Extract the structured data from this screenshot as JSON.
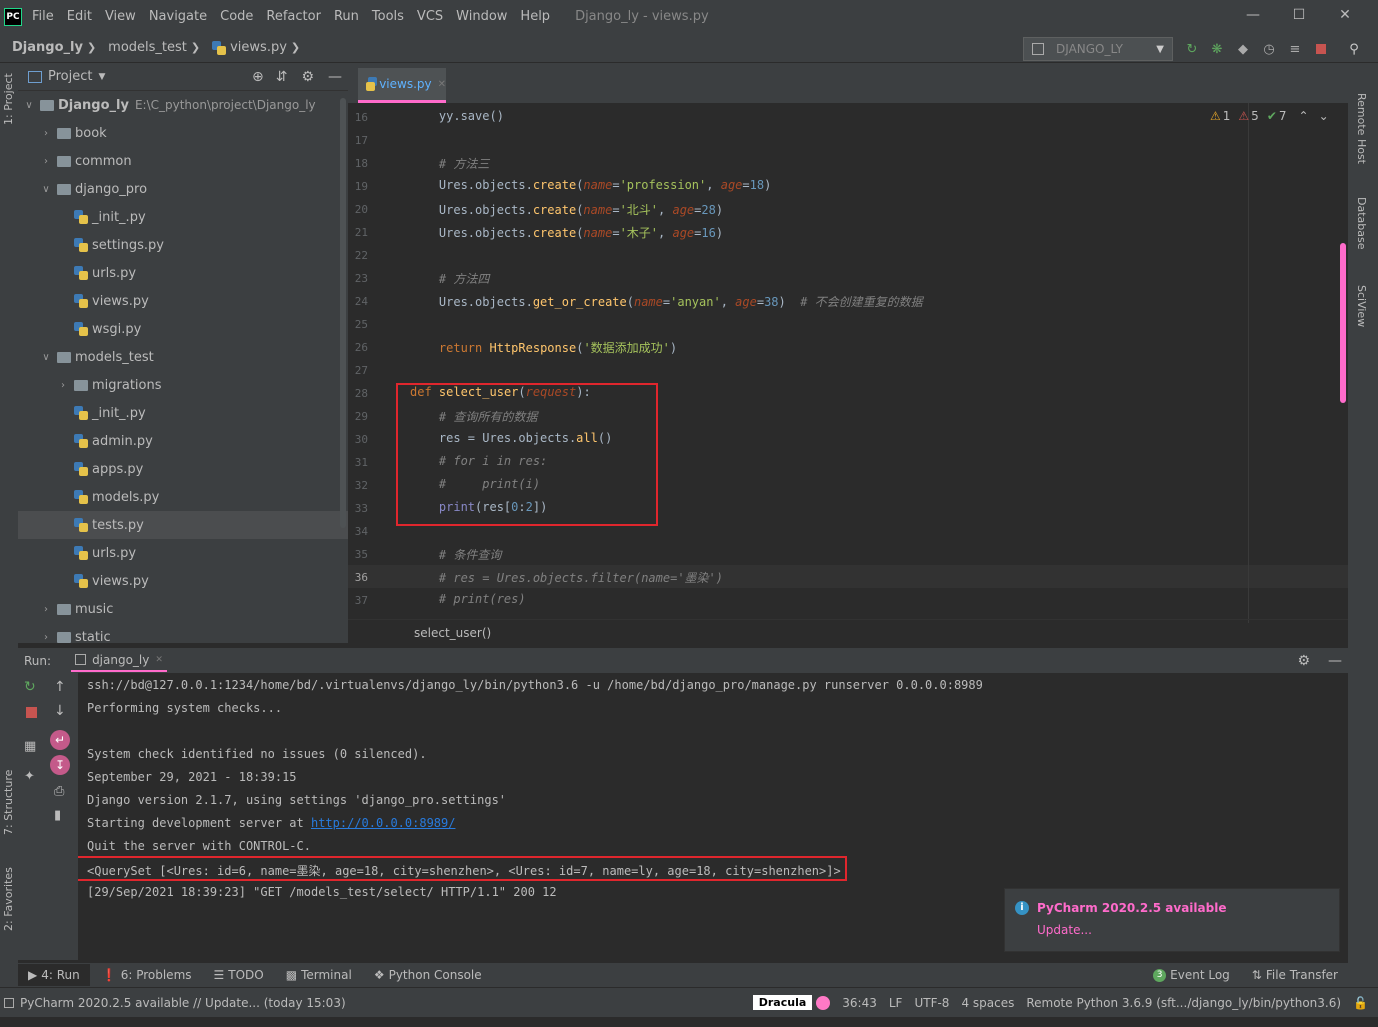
{
  "app": {
    "logo_text": "PC",
    "menu": [
      "File",
      "Edit",
      "View",
      "Navigate",
      "Code",
      "Refactor",
      "Run",
      "Tools",
      "VCS",
      "Window",
      "Help"
    ],
    "window_title": "Django_ly - views.py"
  },
  "breadcrumb": [
    "Django_ly",
    "models_test",
    "views.py"
  ],
  "run_config": "DJANGO_LY",
  "sidebar": {
    "left_tabs": [
      "1: Project",
      "7: Structure",
      "2: Favorites"
    ],
    "right_tabs": [
      "Remote Host",
      "Database",
      "SciView"
    ]
  },
  "project": {
    "title": "Project",
    "root_name": "Django_ly",
    "root_path": "E:\\C_python\\project\\Django_ly",
    "items": [
      {
        "label": "book",
        "type": "folder",
        "expanded": false,
        "depth": 1
      },
      {
        "label": "common",
        "type": "folder",
        "expanded": false,
        "depth": 1
      },
      {
        "label": "django_pro",
        "type": "folder",
        "expanded": true,
        "depth": 1
      },
      {
        "label": "_init_.py",
        "type": "py",
        "depth": 2
      },
      {
        "label": "settings.py",
        "type": "py",
        "depth": 2
      },
      {
        "label": "urls.py",
        "type": "py",
        "depth": 2
      },
      {
        "label": "views.py",
        "type": "py",
        "depth": 2
      },
      {
        "label": "wsgi.py",
        "type": "py",
        "depth": 2
      },
      {
        "label": "models_test",
        "type": "folder",
        "expanded": true,
        "depth": 1
      },
      {
        "label": "migrations",
        "type": "folder",
        "expanded": false,
        "depth": 2
      },
      {
        "label": "_init_.py",
        "type": "py",
        "depth": 2
      },
      {
        "label": "admin.py",
        "type": "py",
        "depth": 2
      },
      {
        "label": "apps.py",
        "type": "py",
        "depth": 2
      },
      {
        "label": "models.py",
        "type": "py",
        "depth": 2
      },
      {
        "label": "tests.py",
        "type": "py",
        "depth": 2,
        "selected": true
      },
      {
        "label": "urls.py",
        "type": "py",
        "depth": 2
      },
      {
        "label": "views.py",
        "type": "py",
        "depth": 2
      },
      {
        "label": "music",
        "type": "folder",
        "expanded": false,
        "depth": 1
      },
      {
        "label": "static",
        "type": "folder",
        "expanded": false,
        "depth": 1
      }
    ]
  },
  "editor": {
    "tab_label": "views.py",
    "inspections": {
      "warn_count": "1",
      "weak_warn_count": "5",
      "ok_count": "7"
    },
    "current_line": "36",
    "breadcrumb_fn": "select_user()",
    "lines": [
      {
        "n": "16",
        "html": "    yy.save()"
      },
      {
        "n": "17",
        "html": ""
      },
      {
        "n": "18",
        "html": "    <span class=\"cm\"># 方法三</span>"
      },
      {
        "n": "19",
        "html": "    Ures.objects.<span class=\"fn\">create</span>(<span class=\"named\">name</span>=<span class=\"st\">'profession'</span>, <span class=\"named\">age</span>=<span class=\"num\">18</span>)"
      },
      {
        "n": "20",
        "html": "    Ures.objects.<span class=\"fn\">create</span>(<span class=\"named\">name</span>=<span class=\"st\">'北斗'</span>, <span class=\"named\">age</span>=<span class=\"num\">28</span>)"
      },
      {
        "n": "21",
        "html": "    Ures.objects.<span class=\"fn\">create</span>(<span class=\"named\">name</span>=<span class=\"st\">'木子'</span>, <span class=\"named\">age</span>=<span class=\"num\">16</span>)"
      },
      {
        "n": "22",
        "html": ""
      },
      {
        "n": "23",
        "html": "    <span class=\"cm\"># 方法四</span>"
      },
      {
        "n": "24",
        "html": "    Ures.objects.<span class=\"fn\">get_or_create</span>(<span class=\"named\">name</span>=<span class=\"st\">'anyan'</span>, <span class=\"named\">age</span>=<span class=\"num\">38</span>)  <span class=\"cm\"># 不会创建重复的数据</span>"
      },
      {
        "n": "25",
        "html": ""
      },
      {
        "n": "26",
        "html": "    <span class=\"kw\">return</span> <span class=\"fn\">HttpResponse</span>(<span class=\"st\">'数据添加成功'</span>)"
      },
      {
        "n": "27",
        "html": ""
      },
      {
        "n": "28",
        "html": "<span class=\"kw\">def</span> <span class=\"fn\">select_user</span>(<span class=\"named\">request</span>):"
      },
      {
        "n": "29",
        "html": "    <span class=\"cm\"># 查询所有的数据</span>"
      },
      {
        "n": "30",
        "html": "    res = Ures.objects.<span class=\"fn\">all</span>()"
      },
      {
        "n": "31",
        "html": "    <span class=\"cm\"># for i in res:</span>"
      },
      {
        "n": "32",
        "html": "    <span class=\"cm\">#     print(i)</span>"
      },
      {
        "n": "33",
        "html": "    <span class=\"bi\">print</span>(res[<span class=\"num\">0</span>:<span class=\"num\">2</span>])"
      },
      {
        "n": "34",
        "html": ""
      },
      {
        "n": "35",
        "html": "    <span class=\"cm\"># 条件查询</span>"
      },
      {
        "n": "36",
        "html": "    <span class=\"cm\"># res = Ures.objects.filter(name='墨染')</span>"
      },
      {
        "n": "37",
        "html": "    <span class=\"cm\"># print(res)</span>"
      }
    ]
  },
  "run": {
    "label": "Run:",
    "tab": "django_ly",
    "output": [
      "ssh://bd@127.0.0.1:1234/home/bd/.virtualenvs/django_ly/bin/python3.6 -u /home/bd/django_pro/manage.py runserver 0.0.0.0:8989",
      "Performing system checks...",
      "",
      "System check identified no issues (0 silenced).",
      "September 29, 2021 - 18:39:15",
      "Django version 2.1.7, using settings 'django_pro.settings'",
      "Starting development server at ",
      "Quit the server with CONTROL-C.",
      "<QuerySet [<Ures: id=6, name=墨染, age=18, city=shenzhen>, <Ures: id=7, name=ly, age=18, city=shenzhen>]>",
      "[29/Sep/2021 18:39:23] \"GET /models_test/select/ HTTP/1.1\" 200 12"
    ],
    "server_link": "http://0.0.0.0:8989/"
  },
  "notification": {
    "title": "PyCharm 2020.2.5 available",
    "action": "Update..."
  },
  "tool_tabs": {
    "run": "4: Run",
    "problems": "6: Problems",
    "todo": "TODO",
    "terminal": "Terminal",
    "python_console": "Python Console",
    "event_log_count": "3",
    "event_log": "Event Log",
    "file_transfer": "File Transfer"
  },
  "status": {
    "message": "PyCharm 2020.2.5 available // Update... (today 15:03)",
    "theme": "Dracula",
    "position": "36:43",
    "line_sep": "LF",
    "encoding": "UTF-8",
    "indent": "4 spaces",
    "interpreter": "Remote Python 3.6.9 (sft.../django_ly/bin/python3.6)"
  },
  "colors": {
    "accent_pink": "#ff6bcb",
    "highlight_red": "#e0262d",
    "link_blue": "#287bde"
  }
}
